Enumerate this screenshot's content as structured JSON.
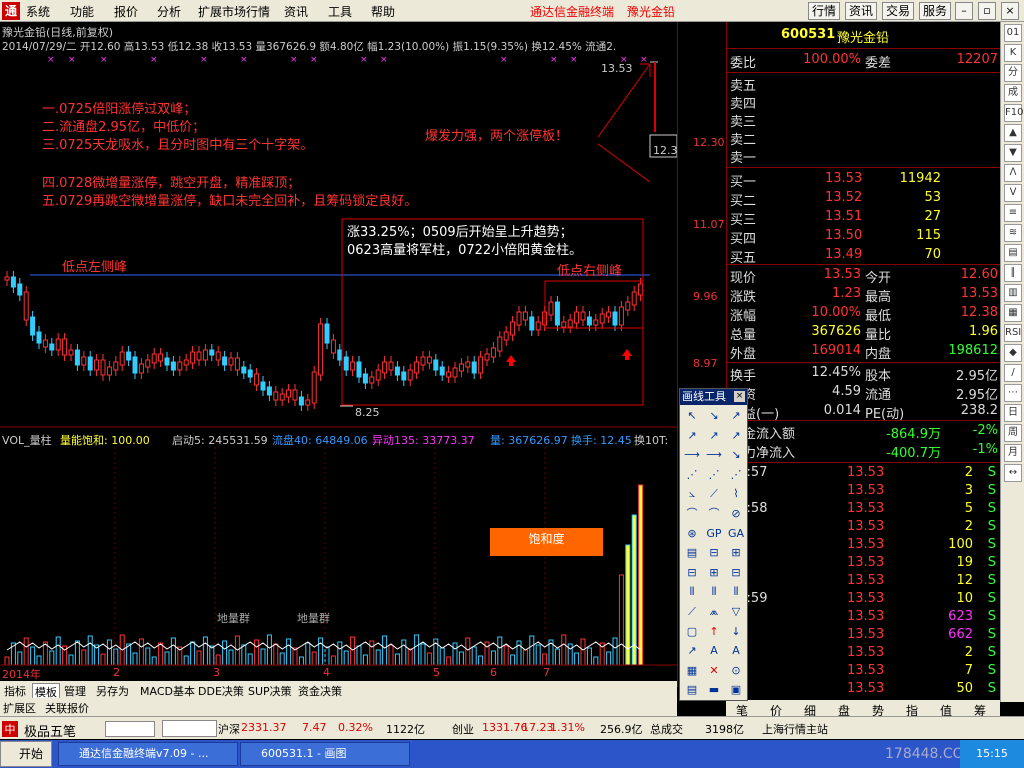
{
  "menubar": {
    "items": [
      "系统",
      "功能",
      "报价",
      "分析",
      "扩展市场行情",
      "资讯",
      "工具",
      "帮助"
    ],
    "brand1": "通达信金融终端",
    "brand2": "豫光金铅",
    "right_buttons": [
      "行情",
      "资讯",
      "交易",
      "服务"
    ]
  },
  "chart": {
    "title": "豫光金铅(日线,前复权)",
    "info": "2014/07/29/二  开12.60 高13.53 低12.38 收13.53 量367626.9 额4.80亿 幅1.23(10.00%) 振1.15(9.35%) 换12.45% 流通2.",
    "price_labels": [
      "13.53",
      "12.30",
      "11.07",
      "9.96",
      "8.97",
      "8.25",
      "12.3"
    ],
    "annotations": {
      "line1": "一.0725倍阳涨停过双峰；",
      "line2": "二.流通盘2.95亿，中低价；",
      "line3": "三.0725天龙吸水，且分时图中有三个十字架。",
      "line4": "四.0728微增量涨停，跳空开盘，精准踩顶；",
      "line5": "五.0729再跳空微增量涨停，缺口未完全回补，且筹码锁定良好。",
      "explosion": "爆发力强，两个涨停板！",
      "rise1": "涨33.25%；0509后开始呈上升趋势；",
      "rise2": "0623高量将军柱，0722小倍阳黄金柱。",
      "left_low": "低点左侧峰",
      "right_low": "低点右侧峰"
    }
  },
  "volume": {
    "title": "VOL_量柱",
    "saturation": "量能饱和: 100.00",
    "start5": "启动5: 245531.59",
    "circ40": "流盘40: 64849.06",
    "move135": "异动135: 33773.37",
    "vol": "量: 367626.97",
    "turnover": "换手: 12.45",
    "turn10": "换10T:",
    "ground1": "地量群",
    "ground2": "地量群",
    "sat_label": "饱和度",
    "months": [
      "2014年",
      "2",
      "3",
      "4",
      "5",
      "6",
      "7"
    ]
  },
  "bottom_tabs": [
    "指标",
    "模板",
    "管理",
    "另存为",
    "MACD基本",
    "DDE决策",
    "SUP决策",
    "资金决策"
  ],
  "bottom_tabs2": [
    "扩展区",
    "关联报价"
  ],
  "quote": {
    "code": "600531",
    "name": "豫光金铅",
    "weibi_label": "委比",
    "weibi": "100.00%",
    "weicha_label": "委差",
    "weicha": "12207",
    "sell": [
      "卖五",
      "卖四",
      "卖三",
      "卖二",
      "卖一"
    ],
    "buy": [
      {
        "l": "买一",
        "p": "13.53",
        "v": "11942"
      },
      {
        "l": "买二",
        "p": "13.52",
        "v": "53"
      },
      {
        "l": "买三",
        "p": "13.51",
        "v": "27"
      },
      {
        "l": "买四",
        "p": "13.50",
        "v": "115"
      },
      {
        "l": "买五",
        "p": "13.49",
        "v": "70"
      }
    ],
    "stats": [
      {
        "l": "现价",
        "v": "13.53",
        "l2": "今开",
        "v2": "12.60"
      },
      {
        "l": "涨跌",
        "v": "1.23",
        "l2": "最高",
        "v2": "13.53"
      },
      {
        "l": "涨幅",
        "v": "10.00%",
        "l2": "最低",
        "v2": "12.38"
      },
      {
        "l": "总量",
        "v": "367626",
        "l2": "量比",
        "v2": "1.96"
      },
      {
        "l": "外盘",
        "v": "169014",
        "l2": "内盘",
        "v2": "198612"
      }
    ],
    "stats2": [
      {
        "l": "换手",
        "v": "12.45%",
        "l2": "股本",
        "v2": "2.95亿"
      },
      {
        "l": "净资",
        "v": "4.59",
        "l2": "流通",
        "v2": "2.95亿"
      },
      {
        "l": "收益(一)",
        "v": "0.014",
        "l2": "PE(动)",
        "v2": "238.2"
      }
    ],
    "flows": [
      {
        "l": "资金流入额",
        "v": "-864.9万",
        "p": "-2%"
      },
      {
        "l": "主力净流入",
        "v": "-400.7万",
        "p": "-1%"
      }
    ],
    "ticks": [
      {
        "t": "14:57",
        "p": "13.53",
        "v": "2",
        "s": "S"
      },
      {
        "t": "",
        "p": "13.53",
        "v": "3",
        "s": "S"
      },
      {
        "t": "14:58",
        "p": "13.53",
        "v": "5",
        "s": "S"
      },
      {
        "t": "",
        "p": "13.53",
        "v": "2",
        "s": "S"
      },
      {
        "t": "",
        "p": "13.53",
        "v": "100",
        "s": "S"
      },
      {
        "t": "",
        "p": "13.53",
        "v": "19",
        "s": "S"
      },
      {
        "t": "",
        "p": "13.53",
        "v": "12",
        "s": "S"
      },
      {
        "t": "14:59",
        "p": "13.53",
        "v": "10",
        "s": "S"
      },
      {
        "t": "",
        "p": "13.53",
        "v": "623",
        "s": "S"
      },
      {
        "t": "",
        "p": "13.53",
        "v": "662",
        "s": "S"
      },
      {
        "t": "",
        "p": "13.53",
        "v": "2",
        "s": "S"
      },
      {
        "t": "",
        "p": "13.53",
        "v": "7",
        "s": "S"
      },
      {
        "t": "",
        "p": "13.53",
        "v": "50",
        "s": "S"
      }
    ],
    "tabs": [
      "笔",
      "价",
      "细",
      "盘",
      "势",
      "指",
      "值",
      "筹"
    ]
  },
  "rside": [
    "01",
    "K",
    "分",
    "成",
    "F10",
    "▲",
    "▼",
    "ᐱ",
    "ᐯ",
    "≡",
    "≋",
    "▤",
    "∥",
    "▥",
    "▦",
    "RSI",
    "◆",
    "/",
    "⋯",
    "日",
    "周",
    "月",
    "↔"
  ],
  "drawtool": {
    "title": "画线工具"
  },
  "statusbar": {
    "sh_label": "沪深",
    "sh": "2331.37",
    "sh_chg": "7.47",
    "sh_pct": "0.32%",
    "sh_amt": "1122亿",
    "cy_label": "创业",
    "cy": "1331.76",
    "cy_chg": "17.23",
    "cy_pct": "1.31%",
    "cy_amt": "256.9亿",
    "total_label": "总成交",
    "total": "3198亿",
    "server": "上海行情主站",
    "app": "极品五笔"
  },
  "taskbar": {
    "start": "开始",
    "task1": "通达信金融终端v7.09 - ...",
    "task2": "600531.1 - 画图",
    "watermark": "178448.COM",
    "clock": "15:15"
  }
}
